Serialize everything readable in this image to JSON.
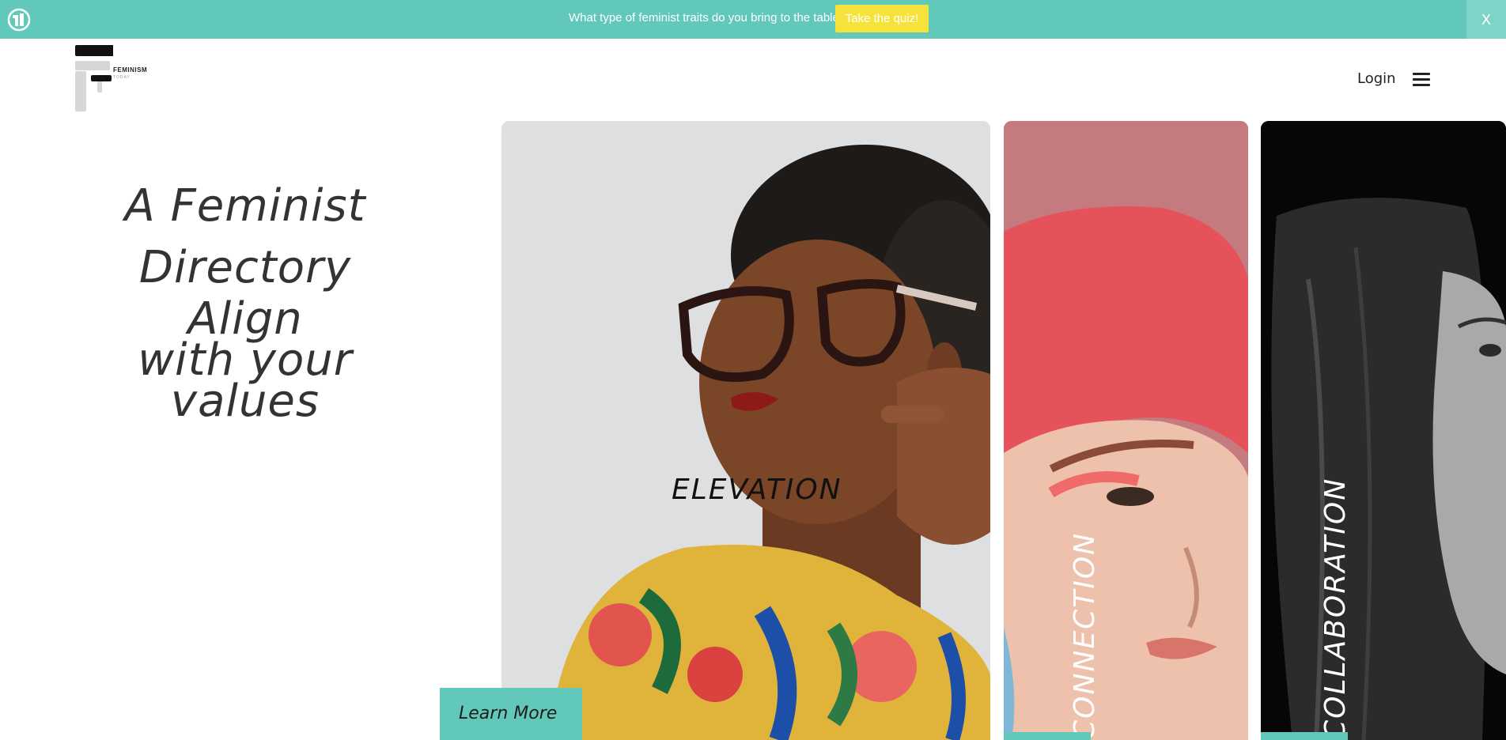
{
  "announcement": {
    "message": "What type of feminist traits do you bring to the table?",
    "cta_label": "Take the quiz!",
    "close_label": "X"
  },
  "header": {
    "logo_wordmark": "FEMINISM",
    "logo_submark": "TODAY",
    "login_label": "Login",
    "menu_icon": "hamburger-menu-icon"
  },
  "hero": {
    "line1": "A Feminist",
    "line2": "Directory",
    "line3": "Align",
    "line4": "with your values"
  },
  "cards": [
    {
      "label": "ELEVATION"
    },
    {
      "label": "CONNECTION"
    },
    {
      "label": "COLLABORATION"
    }
  ],
  "learn_more_label": "Learn More",
  "colors": {
    "accent": "#62c9ba",
    "cta": "#f5e33b",
    "text": "#333333"
  }
}
